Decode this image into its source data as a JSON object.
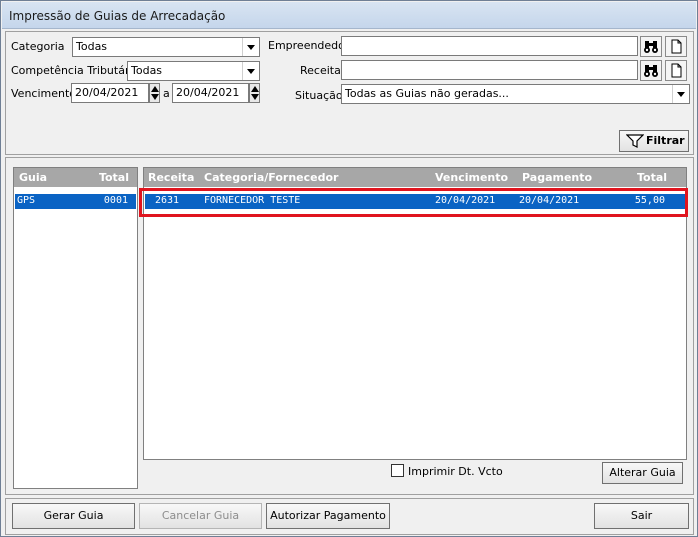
{
  "window": {
    "title": "Impressão de Guias de Arrecadação"
  },
  "filters": {
    "categoria_label": "Categoria",
    "categoria_value": "Todas",
    "competencia_label": "Competência Tributária",
    "competencia_value": "Todas",
    "vencimento_label": "Vencimento",
    "vencimento_from": "20/04/2021",
    "vencimento_sep": "a",
    "vencimento_to": "20/04/2021",
    "empreendedor_label": "Empreendedor",
    "empreendedor_value": "",
    "receita_label": "Receita",
    "receita_value": "",
    "situacao_label": "Situação",
    "situacao_value": "Todas as Guias não geradas...",
    "filtrar_label": "Filtrar"
  },
  "guide_list": {
    "columns": [
      "Guia",
      "Total"
    ],
    "rows": [
      {
        "guia": "GPS",
        "total": "0001"
      }
    ]
  },
  "detail_grid": {
    "columns": [
      "Receita",
      "Categoria/Fornecedor",
      "Vencimento",
      "Pagamento",
      "Total"
    ],
    "rows": [
      {
        "receita": "2631",
        "categoria": "FORNECEDOR TESTE",
        "vencimento": "20/04/2021",
        "pagamento": "20/04/2021",
        "total": "55,00"
      }
    ]
  },
  "options": {
    "imprimir_dt_vcto_label": "Imprimir Dt. Vcto",
    "imprimir_dt_vcto_checked": false,
    "alterar_guia_label": "Alterar Guia"
  },
  "footer": {
    "gerar_guia_label": "Gerar Guia",
    "cancelar_guia_label": "Cancelar Guia",
    "autorizar_pagamento_label": "Autorizar Pagamento",
    "sair_label": "Sair"
  },
  "colors": {
    "selection": "#0a63c4",
    "grid_header": "#a7a7a7",
    "highlight_border": "#e0141e"
  },
  "icons": {
    "binoculars": "binoculars-icon",
    "new_document": "new-document-icon",
    "funnel": "funnel-icon"
  }
}
